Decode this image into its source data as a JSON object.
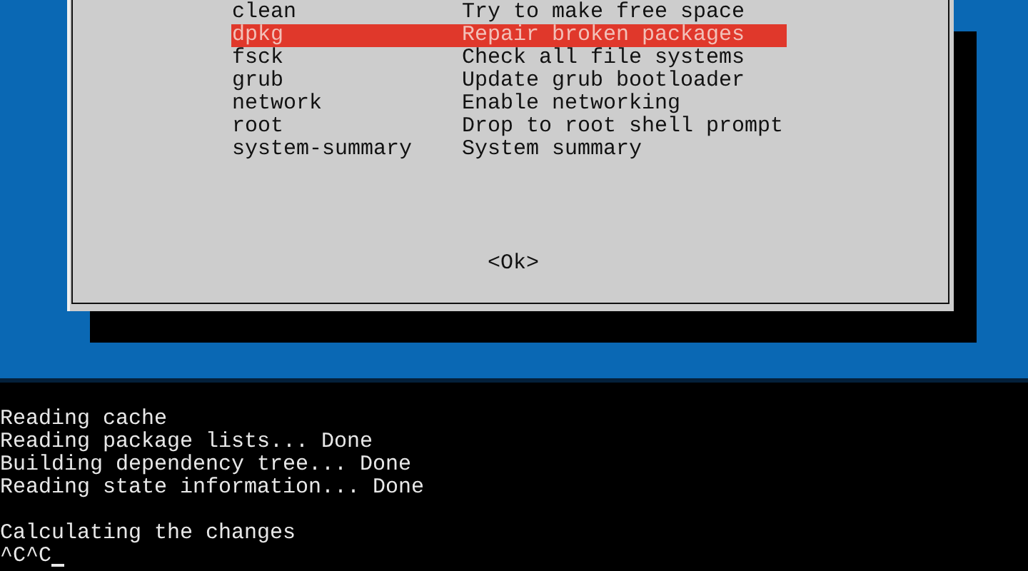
{
  "menu": {
    "items": [
      {
        "name": "clean",
        "description": "Try to make free space",
        "selected": false
      },
      {
        "name": "dpkg",
        "description": "Repair broken packages",
        "selected": true
      },
      {
        "name": "fsck",
        "description": "Check all file systems",
        "selected": false
      },
      {
        "name": "grub",
        "description": "Update grub bootloader",
        "selected": false
      },
      {
        "name": "network",
        "description": "Enable networking",
        "selected": false
      },
      {
        "name": "root",
        "description": "Drop to root shell prompt",
        "selected": false
      },
      {
        "name": "system-summary",
        "description": "System summary",
        "selected": false
      }
    ],
    "ok_button": "<Ok>"
  },
  "terminal": {
    "blocks": [
      [
        "Reading cache",
        "Reading package lists... Done",
        "Building dependency tree... Done",
        "Reading state information... Done"
      ],
      [
        "Calculating the changes"
      ]
    ],
    "prompt": "^C^C"
  }
}
